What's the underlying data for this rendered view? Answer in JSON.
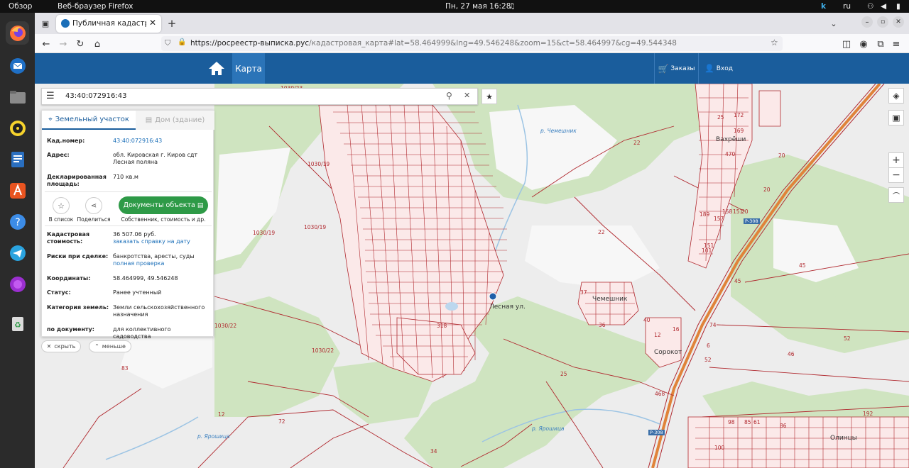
{
  "system_bar": {
    "overview": "Обзор",
    "app_name": "Веб-браузер Firefox",
    "clock": "Пн, 27 мая  16:28",
    "keyboard_layout": "ru"
  },
  "dock": {
    "items": [
      "firefox-icon",
      "thunderbird-icon",
      "files-icon",
      "rhythmbox-icon",
      "writer-icon",
      "appcenter-icon",
      "help-icon",
      "telegram-icon",
      "purple-app-icon",
      "trash-icon"
    ]
  },
  "browser": {
    "tab_title": "Публичная кадастровая",
    "url_host": "https://росреестр-выписка.рус",
    "url_path": "/кадастровая_карта#lat=58.464999&lng=49.546248&zoom=15&ct=58.464997&cg=49.544348"
  },
  "site": {
    "nav_map": "Карта",
    "orders": "Заказы",
    "login": "Вход"
  },
  "search": {
    "value": "43:40:072916:43"
  },
  "panel": {
    "tab_land": "Земельный участок",
    "tab_building": "Дом (здание)",
    "rows_top": [
      {
        "label": "Кад.номер:",
        "value": "43:40:072916:43"
      },
      {
        "label": "Адрес:",
        "value": "обл. Кировская г. Киров сдт Лесная поляна"
      },
      {
        "label": "Декларированная площадь:",
        "value": "710 кв.м"
      }
    ],
    "btn_list": "В список",
    "btn_share": "Поделиться",
    "btn_docs": "Документы объекта",
    "docs_caption": "Собственник, стоимость и др.",
    "rows_bottom": [
      {
        "label": "Кадастровая стоимость:",
        "value": "36 507.06 руб.",
        "link": "заказать справку на дату"
      },
      {
        "label": "Риски при сделке:",
        "value": "банкротства, аресты, суды",
        "link": "полная проверка"
      },
      {
        "label": "Координаты:",
        "value": "58.464999, 49.546248",
        "link": ""
      },
      {
        "label": "Статус:",
        "value": "Ранее учтенный",
        "link": ""
      },
      {
        "label": "Категория земель:",
        "value": "Земли сельскохозяйственного назначения",
        "link": ""
      },
      {
        "label": "по документу:",
        "value": "для коллективного садоводства",
        "link": ""
      }
    ],
    "hide": "скрыть",
    "less": "меньше"
  },
  "map_labels": [
    "1030/23",
    "1030/19",
    "1030/19",
    "1030/19",
    "1030/22",
    "1030/22",
    "22",
    "22",
    "20",
    "20",
    "20",
    "45",
    "45",
    "46",
    "52",
    "52",
    "74",
    "25",
    "12",
    "72",
    "83",
    "34",
    "100",
    "192",
    "Вахрёши",
    "Чемешник",
    "Сорокот",
    "Олинцы",
    "р. Чемешник",
    "р. Ярошица",
    "р. Ярошица",
    "Лесная ул.",
    "318",
    "Р-308",
    "Р-308",
    "468",
    "25",
    "172",
    "169",
    "470",
    "189",
    "158",
    "151",
    "157",
    "101",
    "151",
    "37",
    "36",
    "40",
    "16",
    "12",
    "6",
    "98",
    "85",
    "61",
    "86"
  ],
  "colors": {
    "header_blue": "#1a5d9c",
    "accent_green": "#2e9a47",
    "parcel_red": "#b0282e",
    "road_orange": "#e0833a",
    "forest_green": "#cfe4c0"
  }
}
